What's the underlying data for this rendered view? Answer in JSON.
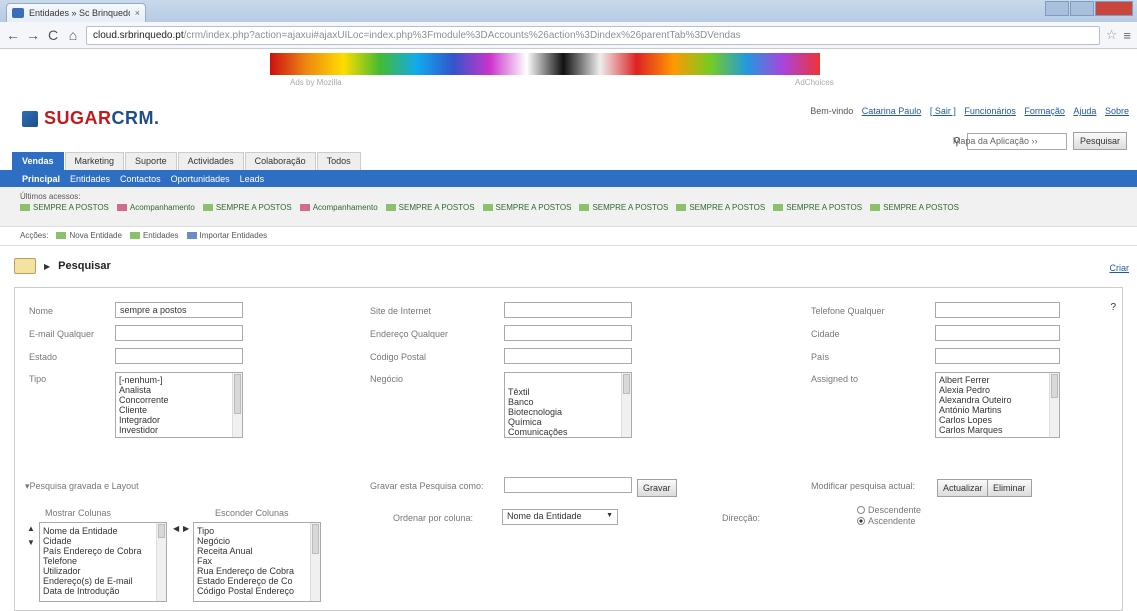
{
  "browser": {
    "tab_title": "Entidades » Sc Brinquedo",
    "tab_close": "×",
    "url_host": "cloud.srbrinquedo.pt",
    "url_path": "/crm/index.php?action=ajaxui#ajaxUILoc=index.php%3Fmodule%3DAccounts%26action%3Dindex%26parentTab%3DVendas",
    "back": "←",
    "forward": "→",
    "reload": "C",
    "home": "⌂",
    "star": "☆",
    "menu": "≡"
  },
  "header": {
    "banner_caption_left": "Ads by Mozilla",
    "banner_caption_right": "AdChoices",
    "logo_text_red": "SUGAR",
    "logo_text_blue": "CRM.",
    "welcome": "Bem-vindo",
    "user": "Catarina Paulo",
    "logout": "[ Sair ]",
    "links": [
      "Funcionários",
      "Formação",
      "Ajuda",
      "Sobre"
    ],
    "sitemap_label": "Mapa da Aplicação ››",
    "search_button": "Pesquisar"
  },
  "module_tabs": [
    "Vendas",
    "Marketing",
    "Suporte",
    "Actividades",
    "Colaboração",
    "Todos"
  ],
  "sub_tabs": [
    "Principal",
    "Entidades",
    "Contactos",
    "Oportunidades",
    "Leads"
  ],
  "last_viewed": {
    "heading": "Últimos acessos:",
    "items": [
      {
        "label": "SEMPRE A POSTOS",
        "pink": false
      },
      {
        "label": "Acompanhamento",
        "pink": true
      },
      {
        "label": "SEMPRE A POSTOS",
        "pink": false
      },
      {
        "label": "Acompanhamento",
        "pink": true
      },
      {
        "label": "SEMPRE A POSTOS",
        "pink": false
      },
      {
        "label": "SEMPRE A POSTOS",
        "pink": false
      },
      {
        "label": "SEMPRE A POSTOS",
        "pink": false
      },
      {
        "label": "SEMPRE A POSTOS",
        "pink": false
      },
      {
        "label": "SEMPRE A POSTOS",
        "pink": false
      },
      {
        "label": "SEMPRE A POSTOS",
        "pink": false
      }
    ]
  },
  "actions": {
    "label": "Acções:",
    "items": [
      "Nova Entidade",
      "Entidades",
      "Importar Entidades"
    ]
  },
  "search": {
    "title": "Pesquisar",
    "create_link": "Criar",
    "help": "?",
    "fields": {
      "nome": {
        "label": "Nome",
        "value": "sempre a postos"
      },
      "site": {
        "label": "Site de Internet",
        "value": ""
      },
      "telefone": {
        "label": "Telefone Qualquer",
        "value": ""
      },
      "email": {
        "label": "E-mail Qualquer",
        "value": ""
      },
      "endereco": {
        "label": "Endereço Qualquer",
        "value": ""
      },
      "cidade": {
        "label": "Cidade",
        "value": ""
      },
      "estado": {
        "label": "Estado",
        "value": ""
      },
      "codigo_postal": {
        "label": "Código Postal",
        "value": ""
      },
      "pais": {
        "label": "País",
        "value": ""
      }
    },
    "tipo": {
      "label": "Tipo",
      "options": [
        "[-nenhum-]",
        "Analista",
        "Concorrente",
        "Cliente",
        "Integrador",
        "Investidor"
      ]
    },
    "negocio": {
      "label": "Negócio",
      "options": [
        "Têxtil",
        "Banco",
        "Biotecnologia",
        "Química",
        "Comunicações"
      ]
    },
    "assigned": {
      "label": "Assigned to",
      "options": [
        "Albert Ferrer",
        "Alexia Pedro",
        "Alexandra Outeiro",
        "António Martins",
        "Carlos Lopes",
        "Carlos Marques"
      ]
    },
    "layout_toggle": "▾Pesquisa gravada e Layout",
    "save_label": "Gravar esta Pesquisa como:",
    "save_button": "Gravar",
    "modify_label": "Modificar pesquisa actual:",
    "update_button": "Actualizar",
    "delete_button": "Eliminar",
    "show_columns_label": "Mostrar Colunas",
    "hide_columns_label": "Esconder Colunas",
    "order_label": "Ordenar por coluna:",
    "order_value": "Nome da Entidade",
    "direction_label": "Direcção:",
    "direction_options": [
      "Descendente",
      "Ascendente"
    ],
    "direction_selected": "Ascendente",
    "show_columns": [
      "Nome da Entidade",
      "Cidade",
      "País Endereço de Cobra",
      "Telefone",
      "Utilizador",
      "Endereço(s) de E-mail",
      "Data de Introdução"
    ],
    "hide_columns": [
      "Tipo",
      "Negócio",
      "Receita Anual",
      "Fax",
      "Rua Endereço de Cobra",
      "Estado Endereço de Co",
      "Código Postal Endereço"
    ]
  },
  "colors": {
    "brand_blue": "#2f6fc3",
    "logo_red": "#c3191c",
    "link_blue": "#1e5aa8"
  }
}
